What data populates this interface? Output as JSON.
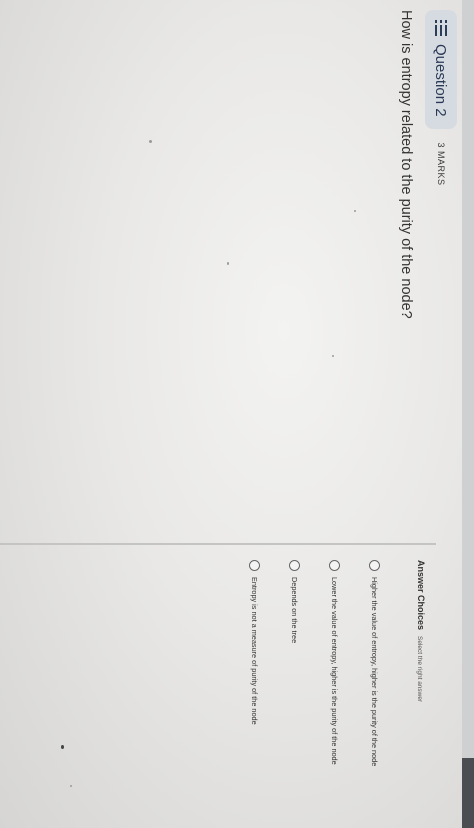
{
  "header": {
    "question_label": "Question 2",
    "marks": "3 MARKS"
  },
  "question": {
    "text": "How is entropy related to the purity of the node?"
  },
  "answers": {
    "heading": "Answer Choices",
    "hint": "Select the right answer",
    "choices": [
      {
        "label": "Higher the value of entropy, higher is the purity of the node",
        "selected": false
      },
      {
        "label": "Lower the value of entropy, higher is the purity of the node",
        "selected": false
      },
      {
        "label": "Depends on the tree",
        "selected": false
      },
      {
        "label": "Entropy is not a measure of purity of the node",
        "selected": false
      }
    ]
  },
  "icons": {
    "question_list": "list-icon"
  },
  "colors": {
    "pill_background": "#d6dbe2",
    "pill_text": "#2a3a55"
  }
}
